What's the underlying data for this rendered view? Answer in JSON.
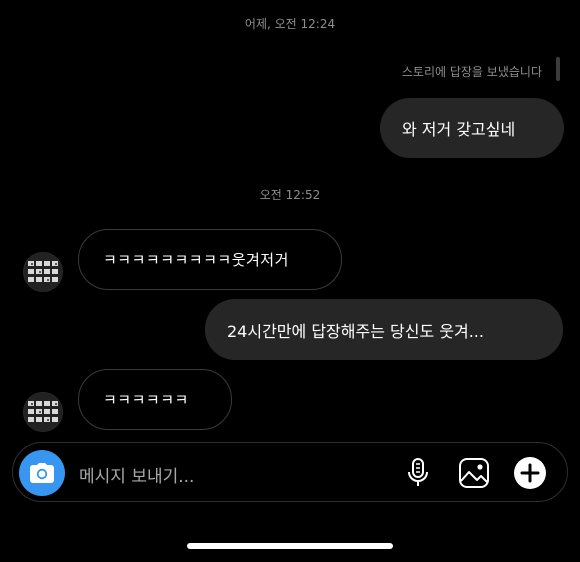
{
  "thread": {
    "timestamp_1": "어제, 오전 12:24",
    "story_reply_note": "스토리에 답장을 보냈습니다",
    "message_1": "와 저거 갖고싶네",
    "timestamp_2": "오전 12:52",
    "message_2": "ㅋㅋㅋㅋㅋㅋㅋㅋㅋ웃겨저거",
    "message_3": "24시간만에 답장해주는 당신도 웃겨...",
    "message_4": "ㅋㅋㅋㅋㅋㅋ"
  },
  "composer": {
    "placeholder": "메시지 보내기..."
  },
  "icons": {
    "camera": "camera-icon",
    "mic": "microphone-icon",
    "gallery": "image-gallery-icon",
    "add": "plus-circle-icon"
  },
  "colors": {
    "background": "#000000",
    "outgoing_bubble": "#262626",
    "camera_button": "#3797f0",
    "muted_text": "#8e8e8e"
  }
}
